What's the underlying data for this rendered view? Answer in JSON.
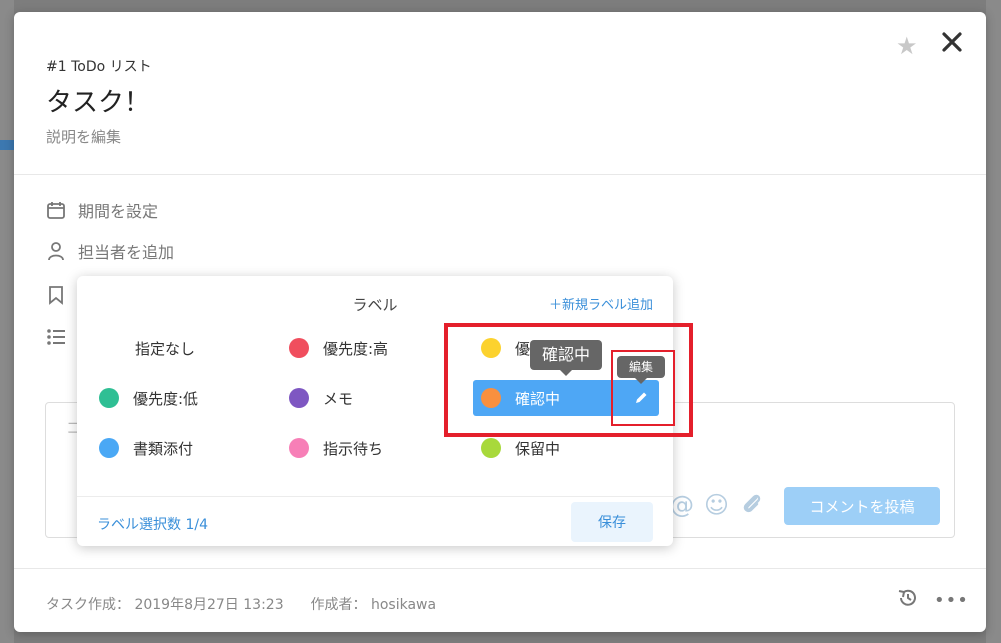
{
  "modal": {
    "breadcrumb": "#1 ToDo リスト",
    "title": "タスク！",
    "description_placeholder": "説明を編集",
    "rows": {
      "period": "期間を設定",
      "assignee": "担当者を追加"
    },
    "comment": {
      "placeholder": "コ",
      "post_label": "コメントを投稿",
      "at": "@",
      "smile": "☺"
    },
    "footer": {
      "created_label": "タスク作成：",
      "created_value": "2019年8月27日 13:23",
      "author_label": "作成者：",
      "author_value": "hosikawa"
    }
  },
  "popover": {
    "title": "ラベル",
    "new_label": "＋新規ラベル追加",
    "labels": [
      {
        "name": "指定なし",
        "color": ""
      },
      {
        "name": "優先度:高",
        "color": "#f04e5e"
      },
      {
        "name": "優先度:中",
        "color": "#fcd22e"
      },
      {
        "name": "優先度:低",
        "color": "#2fbf94"
      },
      {
        "name": "メモ",
        "color": "#7e57c2"
      },
      {
        "name": "確認中",
        "color": "#f9903f",
        "selected": true
      },
      {
        "name": "書類添付",
        "color": "#4aa8f5"
      },
      {
        "name": "指示待ち",
        "color": "#f77fb7"
      },
      {
        "name": "保留中",
        "color": "#a8d93b"
      }
    ],
    "count_text": "ラベル選択数 1/4",
    "save_label": "保存"
  },
  "tooltips": {
    "label_name": "確認中",
    "edit": "編集"
  },
  "colors": {
    "accent": "#3a8fd9",
    "selected_bg": "#4ea7f5",
    "highlight": "#e41f2b"
  }
}
